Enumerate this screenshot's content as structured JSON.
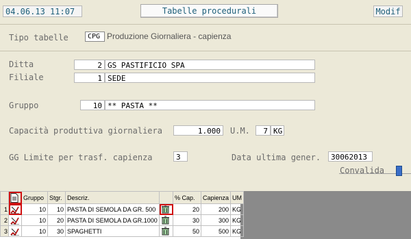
{
  "header": {
    "datetime": "04.06.13 11:07",
    "title": "Tabelle procedurali",
    "mode": "Modif"
  },
  "form": {
    "tipo_tabelle": {
      "label": "Tipo tabelle",
      "code": "CPG",
      "description": "Produzione Giornaliera - capienza"
    },
    "ditta": {
      "label": "Ditta",
      "code": "2",
      "name": "GS PASTIFICIO SPA"
    },
    "filiale": {
      "label": "Filiale",
      "code": "1",
      "name": "SEDE"
    },
    "gruppo": {
      "label": "Gruppo",
      "code": "10",
      "name": "** PASTA **"
    },
    "capacita": {
      "label": "Capacità produttiva giornaliera",
      "value": "1.000",
      "um_label": "U.M.",
      "um_code": "7",
      "um_name": "KG"
    },
    "gg_limite": {
      "label": "GG Limite per trasf. capienza",
      "value": "3"
    },
    "data_ultima": {
      "label": "Data ultima gener.",
      "value": "30062013"
    },
    "convalida": {
      "label": "Convalida"
    }
  },
  "grid": {
    "columns": [
      "",
      "Gruppo",
      "Stgr.",
      "Descriz.",
      "",
      "% Cap.",
      "Capienza",
      "UM"
    ],
    "rows": [
      {
        "n": "1",
        "gruppo": "10",
        "stgr": "10",
        "descr": "PASTA DI SEMOLA DA GR. 500",
        "cap": "20",
        "capienza": "200",
        "um": "KG"
      },
      {
        "n": "2",
        "gruppo": "10",
        "stgr": "20",
        "descr": "PASTA DI SEMOLA DA GR.1000",
        "cap": "30",
        "capienza": "300",
        "um": "KG"
      },
      {
        "n": "3",
        "gruppo": "10",
        "stgr": "30",
        "descr": "SPAGHETTI",
        "cap": "50",
        "capienza": "500",
        "um": "KG"
      }
    ]
  },
  "colors": {
    "accent": "#1d5f7a",
    "highlight": "#d01010",
    "convalida_box": "#3a6ec8"
  }
}
